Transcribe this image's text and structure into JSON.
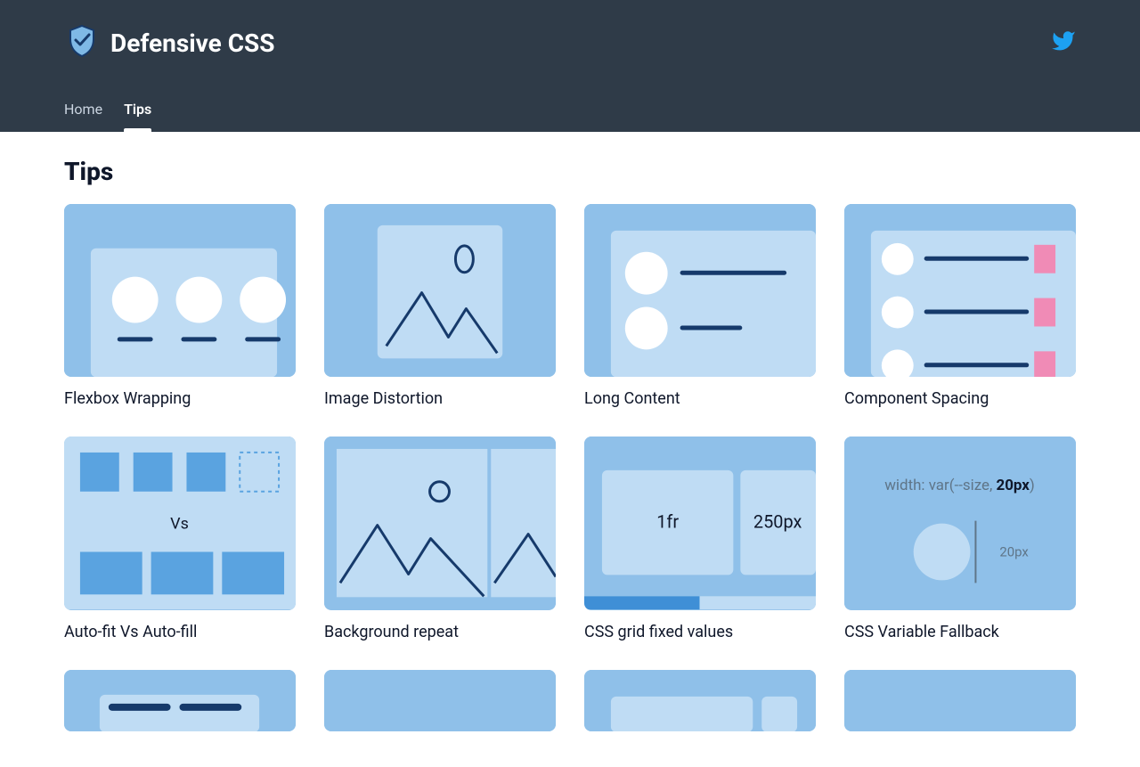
{
  "brand": {
    "title": "Defensive CSS"
  },
  "nav": {
    "items": [
      {
        "label": "Home",
        "active": false
      },
      {
        "label": "Tips",
        "active": true
      }
    ]
  },
  "page": {
    "title": "Tips"
  },
  "colors": {
    "header_bg": "#2f3b48",
    "card_bg": "#8fc0e9",
    "card_inner": "#bfdcf4",
    "stroke": "#163a6b",
    "accent_blue": "#5aa3e0",
    "accent_pink": "#f08bb6",
    "twitter": "#1da1f2"
  },
  "cards": [
    {
      "title": "Flexbox Wrapping",
      "illus": "flexwrap"
    },
    {
      "title": "Image Distortion",
      "illus": "imgdist"
    },
    {
      "title": "Long Content",
      "illus": "longcontent"
    },
    {
      "title": "Component Spacing",
      "illus": "compspacing"
    },
    {
      "title": "Auto-fit Vs Auto-fill",
      "illus": "autofit",
      "text": {
        "vs": "Vs"
      }
    },
    {
      "title": "Background repeat",
      "illus": "bgrepeat"
    },
    {
      "title": "CSS grid fixed values",
      "illus": "gridfixed",
      "text": {
        "a": "1fr",
        "b": "250px"
      }
    },
    {
      "title": "CSS Variable Fallback",
      "illus": "varfallback",
      "text": {
        "line": "width: var(--size, ",
        "bold": "20px",
        "tail": ")",
        "side": "20px"
      }
    }
  ],
  "peek_count": 4
}
